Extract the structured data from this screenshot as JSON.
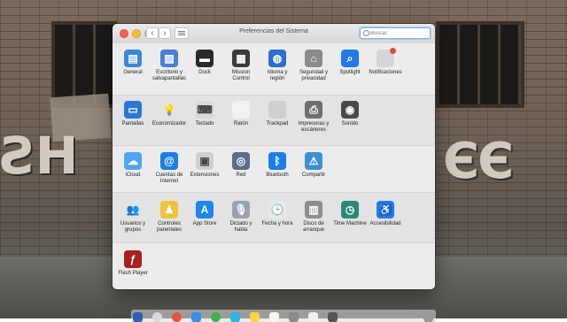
{
  "window": {
    "title": "Preferencias del Sistema",
    "search_placeholder": "Buscar"
  },
  "sections": [
    [
      {
        "label": "General",
        "icon": "general-icon"
      },
      {
        "label": "Escritorio y salvapantallas",
        "icon": "desktop-icon"
      },
      {
        "label": "Dock",
        "icon": "dock-icon"
      },
      {
        "label": "Mission Control",
        "icon": "mission-control-icon"
      },
      {
        "label": "Idioma y región",
        "icon": "flag-icon"
      },
      {
        "label": "Seguridad y privacidad",
        "icon": "house-lock-icon"
      },
      {
        "label": "Spotlight",
        "icon": "magnifier-icon"
      },
      {
        "label": "Notificaciones",
        "icon": "notifications-icon"
      }
    ],
    [
      {
        "label": "Pantallas",
        "icon": "display-icon"
      },
      {
        "label": "Economizador",
        "icon": "lightbulb-icon"
      },
      {
        "label": "Teclado",
        "icon": "keyboard-icon"
      },
      {
        "label": "Ratón",
        "icon": "mouse-icon"
      },
      {
        "label": "Trackpad",
        "icon": "trackpad-icon"
      },
      {
        "label": "Impresoras y escáneres",
        "icon": "printer-icon"
      },
      {
        "label": "Sonido",
        "icon": "speaker-icon"
      }
    ],
    [
      {
        "label": "iCloud",
        "icon": "cloud-icon"
      },
      {
        "label": "Cuentas de Internet",
        "icon": "at-icon"
      },
      {
        "label": "Extensiones",
        "icon": "puzzle-icon"
      },
      {
        "label": "Red",
        "icon": "globe-icon"
      },
      {
        "label": "Bluetooth",
        "icon": "bluetooth-icon"
      },
      {
        "label": "Compartir",
        "icon": "sharing-folder-icon"
      }
    ],
    [
      {
        "label": "Usuarios y grupos",
        "icon": "users-icon"
      },
      {
        "label": "Controles parentales",
        "icon": "parental-controls-icon"
      },
      {
        "label": "App Store",
        "icon": "app-store-icon"
      },
      {
        "label": "Dictado y habla",
        "icon": "microphone-icon"
      },
      {
        "label": "Fecha y hora",
        "icon": "calendar-clock-icon"
      },
      {
        "label": "Disco de arranque",
        "icon": "disk-icon"
      },
      {
        "label": "Time Machine",
        "icon": "time-machine-icon"
      },
      {
        "label": "Accesibilidad",
        "icon": "accessibility-icon"
      }
    ],
    [
      {
        "label": "Flash Player",
        "icon": "flash-icon"
      }
    ]
  ],
  "colors": {
    "accent_blue": "#1a82f7",
    "close_red": "#fc5f57",
    "minimize_yellow": "#fdbc2e"
  }
}
